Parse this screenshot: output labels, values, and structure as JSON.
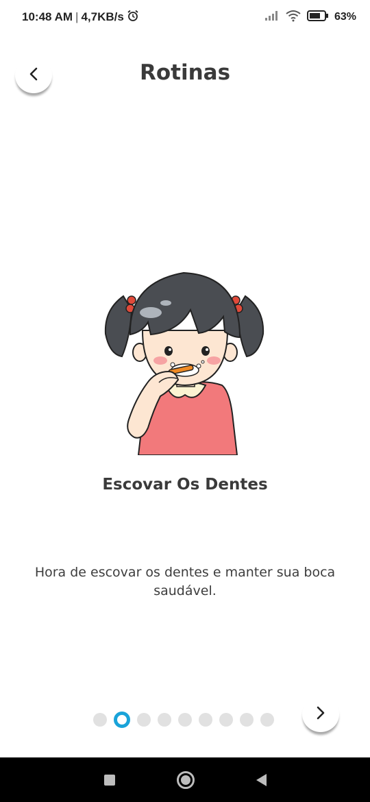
{
  "status_bar": {
    "time": "10:48 AM",
    "speed": "4,7KB/s",
    "battery": "63%",
    "icons": [
      "alarm-icon",
      "signal-icon",
      "wifi-icon",
      "battery-icon"
    ]
  },
  "header": {
    "title": "Rotinas",
    "back_icon": "chevron-left-icon"
  },
  "routine": {
    "title": "Escovar Os Dentes",
    "description": "Hora de escovar os dentes e manter sua boca saudável."
  },
  "pager": {
    "total": 9,
    "current": 2,
    "next_icon": "chevron-right-icon"
  },
  "colors": {
    "accent": "#1aa3d9",
    "dot_inactive": "#e1e1e1",
    "title_text": "#3a3a3a"
  },
  "nav_bar": {
    "icons": [
      "recents-icon",
      "home-icon",
      "back-icon"
    ]
  }
}
